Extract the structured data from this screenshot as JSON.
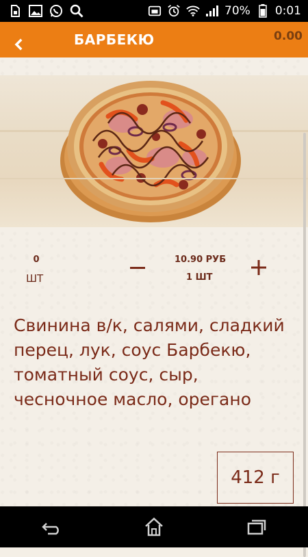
{
  "status_bar": {
    "battery": "70%",
    "time": "0:01",
    "icons": [
      "sim-icon",
      "image-icon",
      "whatsapp-icon",
      "search-icon",
      "android-icon",
      "alarm-icon",
      "wifi-icon",
      "signal-icon",
      "battery-icon"
    ]
  },
  "header": {
    "title": "БАРБЕКЮ",
    "total": "0.00",
    "back_icon": "chevron-left-icon",
    "background": "#ec7e14"
  },
  "product": {
    "count": "0",
    "count_unit": "ШТ",
    "price": "10.90 РУБ",
    "per_unit": "1 ШТ",
    "description": "Свинина в/к, салями, сладкий перец, лук, соус Барбекю, томатный соус, сыр, чесночное масло, орегано",
    "weight": "412 г"
  },
  "navbar": {
    "icons": [
      "back-icon",
      "home-icon",
      "recents-icon"
    ]
  }
}
